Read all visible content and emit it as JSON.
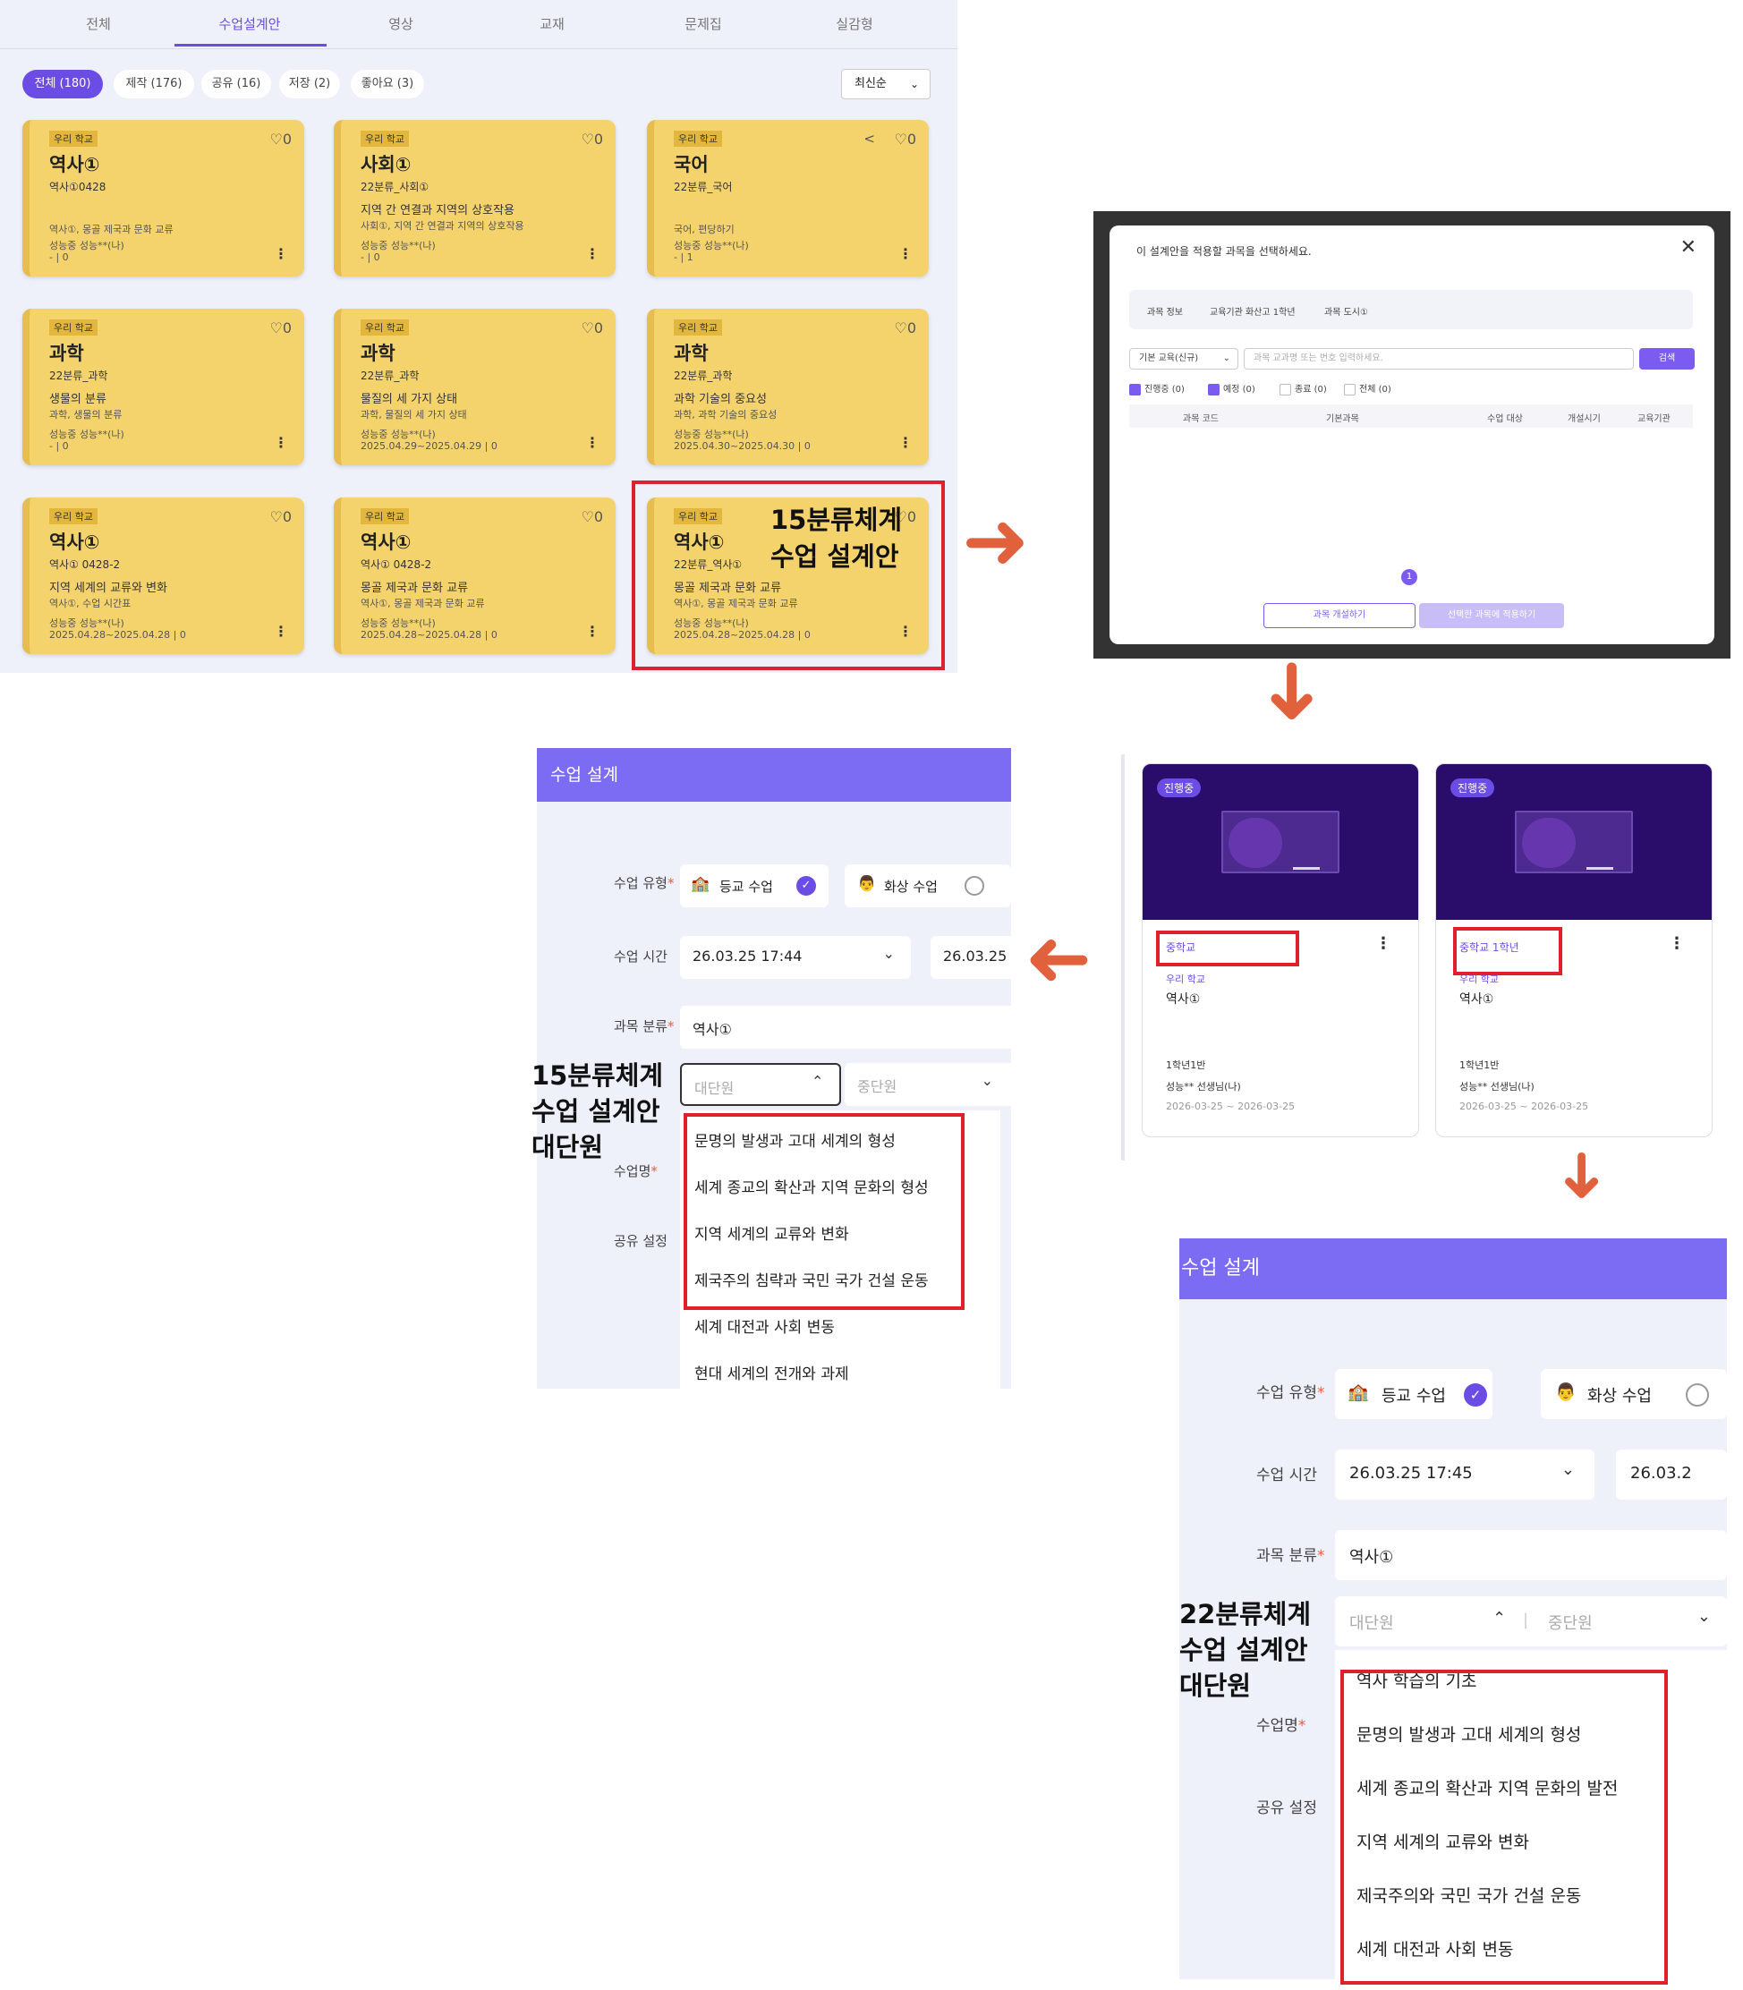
{
  "lesson_list": {
    "tabs": [
      "전체",
      "수업설계안",
      "영상",
      "교재",
      "문제집",
      "실감형"
    ],
    "active_tab": "수업설계안",
    "filters": [
      "전체 (180)",
      "제작 (176)",
      "공유 (16)",
      "저장 (2)",
      "좋아요 (3)"
    ],
    "sort": "최신순",
    "cards": [
      {
        "badge": "우리 학교",
        "subject": "역사①",
        "code": "역사①0428",
        "line1": "",
        "line2": "역사①, 몽골 제국과 문화 교류",
        "line3": "성능중 성능**(나)",
        "line4": "- | 0",
        "likes": "0"
      },
      {
        "badge": "우리 학교",
        "subject": "사회①",
        "code": "22분류_사회①",
        "line1": "지역 간 연결과 지역의 상호작용",
        "line2": "사회①, 지역 간 연결과 지역의 상호작용",
        "line3": "성능중 성능**(나)",
        "line4": "- | 0",
        "likes": "0"
      },
      {
        "badge": "우리 학교",
        "subject": "국어",
        "code": "22분류_국어",
        "line1": "",
        "line2": "국어, 편당하기",
        "line3": "성능중 성능**(나)",
        "line4": "- | 1",
        "likes": "0"
      },
      {
        "badge": "우리 학교",
        "subject": "과학",
        "code": "22분류_과학",
        "line1": "생물의 분류",
        "line2": "과학, 생물의 분류",
        "line3": "성능중 성능**(나)",
        "line4": "- | 0",
        "likes": "0"
      },
      {
        "badge": "우리 학교",
        "subject": "과학",
        "code": "22분류_과학",
        "line1": "물질의 세 가지 상태",
        "line2": "과학, 물질의 세 가지 상태",
        "line3": "성능중 성능**(나)",
        "line4": "2025.04.29~2025.04.29 | 0",
        "likes": "0"
      },
      {
        "badge": "우리 학교",
        "subject": "과학",
        "code": "22분류_과학",
        "line1": "과학 기술의 중요성",
        "line2": "과학, 과학 기술의 중요성",
        "line3": "성능중 성능**(나)",
        "line4": "2025.04.30~2025.04.30 | 0",
        "likes": "0"
      },
      {
        "badge": "우리 학교",
        "subject": "역사①",
        "code": "역사① 0428-2",
        "line1": "지역 세계의 교류와 변화",
        "line2": "역사①, 수업 시간표",
        "line3": "성능중 성능**(나)",
        "line4": "2025.04.28~2025.04.28 | 0",
        "likes": "0"
      },
      {
        "badge": "우리 학교",
        "subject": "역사①",
        "code": "역사① 0428-2",
        "line1": "몽골 제국과 문화 교류",
        "line2": "역사①, 몽골 제국과 문화 교류",
        "line3": "성능중 성능**(나)",
        "line4": "2025.04.28~2025.04.28 | 0",
        "likes": "0"
      },
      {
        "badge": "우리 학교",
        "subject": "역사①",
        "code": "22분류_역사①",
        "line1": "몽골 제국과 문화 교류",
        "line2": "역사①, 몽골 제국과 문화 교류",
        "line3": "성능중 성능**(나)",
        "line4": "2025.04.28~2025.04.28 | 0",
        "likes": "0"
      }
    ],
    "highlight_label_1": "15분류체계",
    "highlight_label_2": "수업 설계안"
  },
  "modal": {
    "title": "이 설계안을 적용할 과목을 선택하세요.",
    "info": [
      "과목 정보",
      "교육기관 화산고 1학년",
      "과목 도시①"
    ],
    "select": "기본 교육(신규)",
    "search_placeholder": "과목 교과명 또는 번호 입력하세요.",
    "search_button": "검색",
    "checks": [
      "진행중 (0)",
      "예정 (0)",
      "종료 (0)",
      "전체 (0)"
    ],
    "columns": [
      "과목 코드",
      "기본과목",
      "수업 대상",
      "개설시기",
      "교육기관"
    ],
    "page": "1",
    "button_open": "과목 개설하기",
    "button_apply": "선택한 과목에 적용하기"
  },
  "classrooms": [
    {
      "status": "진행중",
      "level": "중학교",
      "school": "우리 학교",
      "subject": "역사①",
      "semester": "1학년1반",
      "teacher": "성능** 선생님(나)",
      "dates": "2026-03-25 ~ 2026-03-25"
    },
    {
      "status": "진행중",
      "level": "중학교 1학년",
      "school": "우리 학교",
      "subject": "역사①",
      "semester": "1학년1반",
      "teacher": "성능** 선생님(나)",
      "dates": "2026-03-25 ~ 2026-03-25"
    }
  ],
  "design_15": {
    "header": "수업 설계",
    "label_type": "수업 유형",
    "opt_school": "등교 수업",
    "opt_video": "화상 수업",
    "label_time": "수업 시간",
    "time_start": "26.03.25 17:44",
    "time_end": "26.03.25",
    "label_subject": "과목 분류",
    "subject_value": "역사①",
    "unit_major": "대단원",
    "unit_middle": "중단원",
    "label_name": "수업명",
    "label_share": "공유 설정",
    "dropdown": [
      "문명의 발생과 고대 세계의 형성",
      "세계 종교의 확산과 지역 문화의 형성",
      "지역 세계의 교류와 변화",
      "제국주의 침략과 국민 국가 건설 운동",
      "세계 대전과 사회 변동",
      "현대 세계의 전개와 과제"
    ],
    "overlay": [
      "15분류체계",
      "수업 설계안",
      "대단원"
    ]
  },
  "design_22": {
    "header": "수업 설계",
    "label_type": "수업 유형",
    "opt_school": "등교 수업",
    "opt_video": "화상 수업",
    "label_time": "수업 시간",
    "time_start": "26.03.25 17:45",
    "time_end": "26.03.2",
    "label_subject": "과목 분류",
    "subject_value": "역사①",
    "unit_major": "대단원",
    "unit_middle": "중단원",
    "label_name": "수업명",
    "label_share": "공유 설정",
    "dropdown": [
      "역사 학습의 기초",
      "문명의 발생과 고대 세계의 형성",
      "세계 종교의 확산과 지역 문화의 발전",
      "지역 세계의 교류와 변화",
      "제국주의와 국민 국가 건설 운동",
      "세계 대전과 사회 변동"
    ],
    "overlay": [
      "22분류체계",
      "수업 설계안",
      "대단원"
    ]
  },
  "colors": {
    "accent": "#6b4de6",
    "card": "#f5d36c",
    "arrow": "#e2613d",
    "highlight": "#e0202a"
  }
}
